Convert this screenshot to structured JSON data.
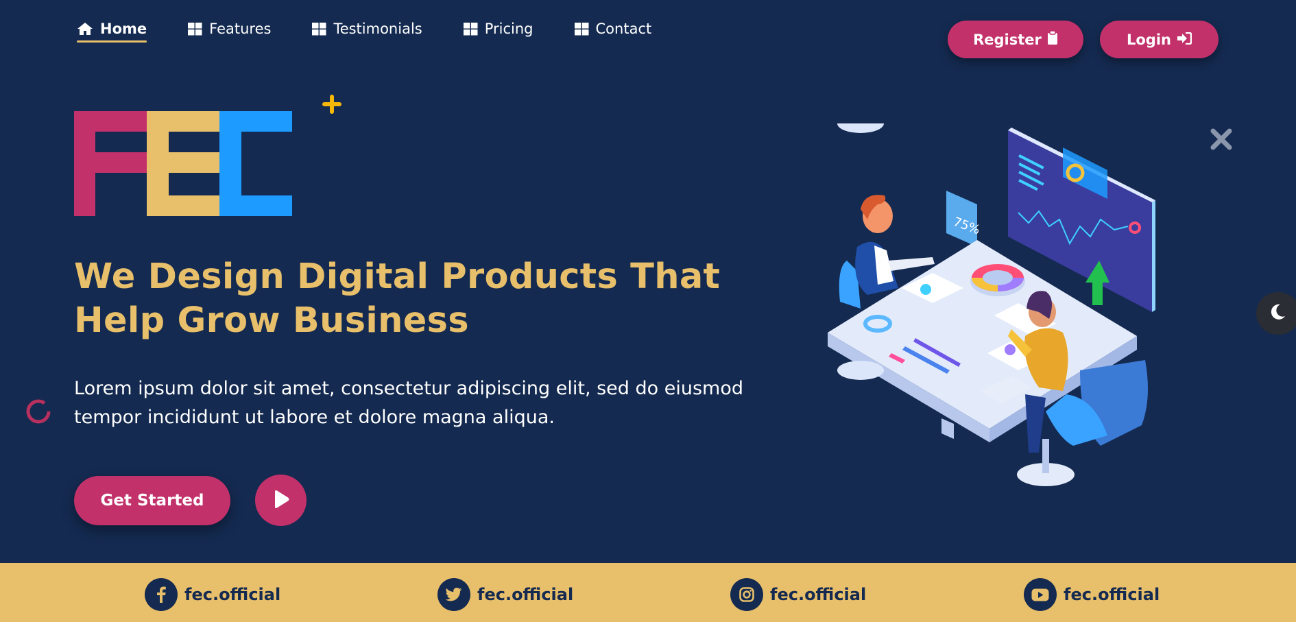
{
  "nav": {
    "items": [
      {
        "label": "Home",
        "icon": "home-icon",
        "active": true
      },
      {
        "label": "Features",
        "icon": "grid-icon",
        "active": false
      },
      {
        "label": "Testimonials",
        "icon": "grid-icon",
        "active": false
      },
      {
        "label": "Pricing",
        "icon": "grid-icon",
        "active": false
      },
      {
        "label": "Contact",
        "icon": "grid-icon",
        "active": false
      }
    ]
  },
  "auth": {
    "register_label": "Register",
    "register_icon": "clipboard-icon",
    "login_label": "Login",
    "login_icon": "sign-in-icon"
  },
  "logo": {
    "text": "FEC",
    "colors": [
      "#c2316a",
      "#e8bf6a",
      "#1e9bff"
    ]
  },
  "hero": {
    "headline": "We Design Digital Products That Help Grow Business",
    "subtext": "Lorem ipsum dolor sit amet, consectetur adipiscing elit, sed do eiusmod tempor incididunt ut labore et dolore magna aliqua.",
    "cta_label": "Get Started",
    "play_icon": "play-icon"
  },
  "illustration": {
    "badge_text": "75%"
  },
  "theme_toggle": {
    "icon": "moon-icon"
  },
  "socials": [
    {
      "icon": "facebook-icon",
      "handle": "fec.official"
    },
    {
      "icon": "twitter-icon",
      "handle": "fec.official"
    },
    {
      "icon": "instagram-icon",
      "handle": "fec.official"
    },
    {
      "icon": "youtube-icon",
      "handle": "fec.official"
    }
  ],
  "colors": {
    "background": "#142a50",
    "accent_pink": "#c2316a",
    "accent_gold": "#e8bf6a",
    "accent_blue": "#1e9bff"
  }
}
